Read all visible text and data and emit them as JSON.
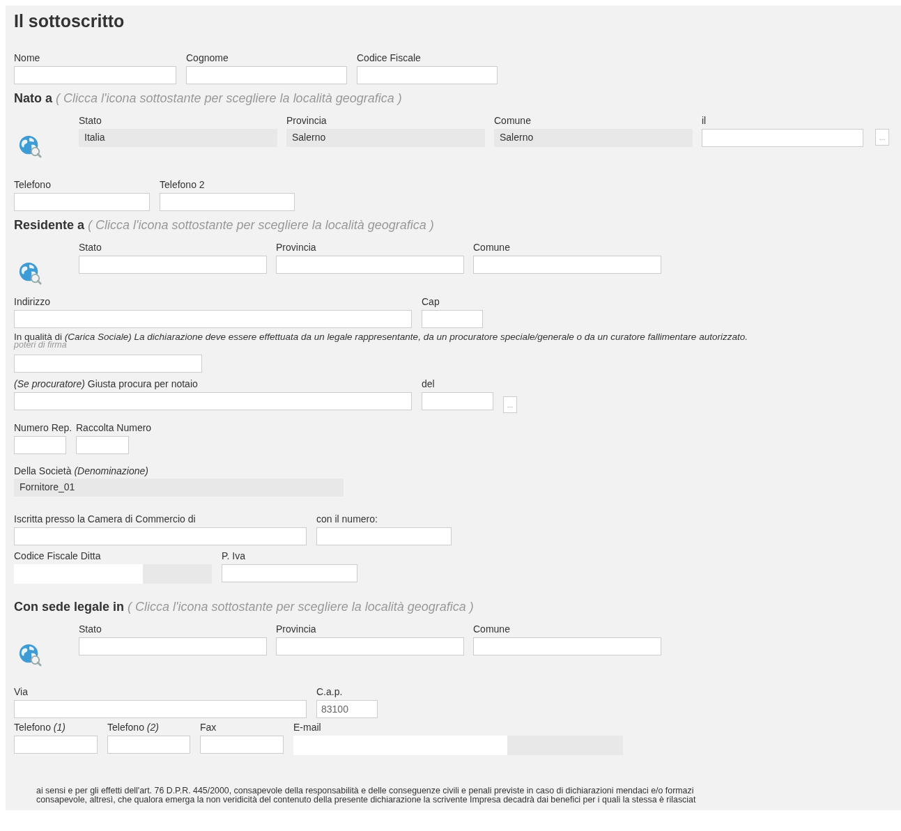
{
  "title": "Il sottoscritto",
  "person": [
    {
      "label": "Nome"
    },
    {
      "label": "Cognome"
    },
    {
      "label": "Codice Fiscale"
    }
  ],
  "birth": {
    "heading": "Nato a",
    "hint": "( Clicca l'icona sottostante per scegliere la località geografica )",
    "fields": [
      {
        "label": "Stato",
        "value": "Italia"
      },
      {
        "label": "Provincia",
        "value": "Salerno"
      },
      {
        "label": "Comune",
        "value": "Salerno"
      }
    ],
    "date": {
      "label": "il",
      "button": "..."
    }
  },
  "phones": [
    {
      "label": "Telefono"
    },
    {
      "label": "Telefono 2"
    }
  ],
  "residence": {
    "heading": "Residente a",
    "hint": "( Clicca l'icona sottostante per scegliere la località geografica )",
    "fields": [
      {
        "label": "Stato"
      },
      {
        "label": "Provincia"
      },
      {
        "label": "Comune"
      }
    ]
  },
  "address": [
    {
      "label": "Indirizzo"
    },
    {
      "label": "Cap"
    }
  ],
  "role": {
    "label": "In qualità di *(Carica Sociale) La dichiarazione deve essere effettuata da un legale rappresentante, da un procuratore speciale/generale o da un curatore fallimentare autorizzato.*",
    "sublabel": "poteri di firma"
  },
  "procura": [
    {
      "label": "*(Se procuratore)* Giusta procura per notaio"
    },
    {
      "label": "del",
      "button": "..."
    }
  ],
  "repertorio": [
    {
      "label": "Numero Rep."
    },
    {
      "label": "Raccolta Numero"
    }
  ],
  "company": {
    "label": "Della Società *(Denominazione)*",
    "value": "Fornitore_01"
  },
  "registry": [
    {
      "label": "Iscritta presso la Camera di Commercio di"
    },
    {
      "label": "con il numero:"
    }
  ],
  "tax": [
    {
      "label": "Codice Fiscale Ditta",
      "kind": "masked"
    },
    {
      "label": "P. Iva",
      "kind": "input"
    }
  ],
  "seat": {
    "heading": "Con sede legale in",
    "hint": "( Clicca l'icona sottostante per scegliere la località geografica )",
    "fields": [
      {
        "label": "Stato"
      },
      {
        "label": "Provincia"
      },
      {
        "label": "Comune"
      }
    ]
  },
  "street": [
    {
      "label": "Via"
    },
    {
      "label": "C.a.p.",
      "value": "83100"
    }
  ],
  "contacts": [
    {
      "label": "Telefono *(1)*",
      "kind": "input"
    },
    {
      "label": "Telefono *(2)*",
      "kind": "input"
    },
    {
      "label": "Fax",
      "kind": "input"
    },
    {
      "label": "E-mail",
      "kind": "masked"
    }
  ],
  "declaration": [
    "ai sensi e per gli effetti dell'art. 76 D.P.R. 445/2000, consapevole della responsabilità e delle conseguenze civili e penali previste in caso di dichiarazioni mendaci e/o formazi",
    "consapevole, altresì, che qualora emerga la non veridicità del contenuto della presente dichiarazione la scrivente Impresa decadrà dai benefici per i quali la stessa è rilasciat"
  ]
}
